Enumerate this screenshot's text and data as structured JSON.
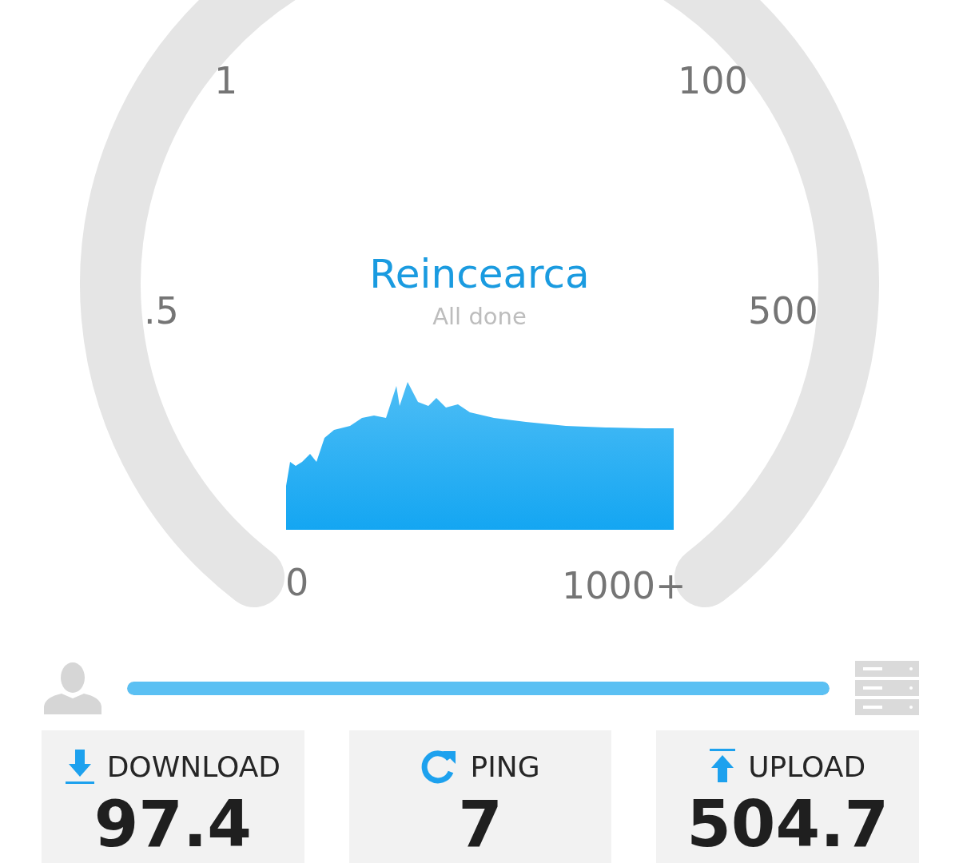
{
  "gauge": {
    "scale_labels": [
      {
        "text": "1",
        "kind": "top-left"
      },
      {
        "text": "100",
        "kind": "top-right"
      },
      {
        "text": ".5",
        "kind": "mid-left"
      },
      {
        "text": "500",
        "kind": "mid-right"
      },
      {
        "text": "0",
        "kind": "bottom-left"
      },
      {
        "text": "1000+",
        "kind": "bottom-right"
      }
    ],
    "title": "Reincearca",
    "status": "All done"
  },
  "progress": {
    "level": 1
  },
  "results": [
    {
      "kind": "download",
      "label": "DOWNLOAD",
      "value": "97.4"
    },
    {
      "kind": "ping",
      "label": "PING",
      "value": "7"
    },
    {
      "kind": "upload",
      "label": "UPLOAD",
      "value": "504.7"
    }
  ]
}
